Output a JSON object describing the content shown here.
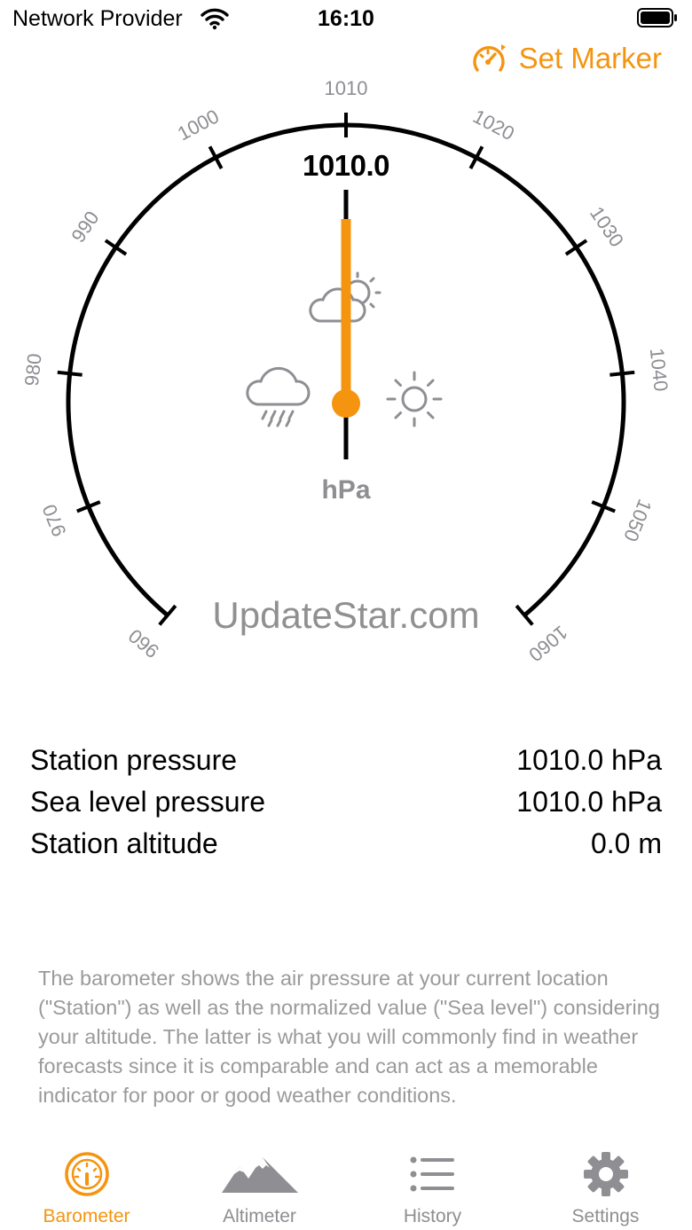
{
  "status_bar": {
    "carrier": "Network Provider",
    "time": "16:10"
  },
  "toolbar": {
    "set_marker_label": "Set Marker"
  },
  "gauge": {
    "value": "1010.0",
    "unit": "hPa",
    "ticks": [
      "960",
      "970",
      "980",
      "990",
      "1000",
      "1010",
      "1020",
      "1030",
      "1040",
      "1050",
      "1060"
    ],
    "needle_value": 1010.0,
    "range": [
      960,
      1060
    ],
    "icons": [
      "rain-cloud-icon",
      "partly-cloudy-icon",
      "sun-icon"
    ]
  },
  "watermark": "UpdateStar.com",
  "readings": [
    {
      "label": "Station pressure",
      "value": "1010.0 hPa"
    },
    {
      "label": "Sea level pressure",
      "value": "1010.0 hPa"
    },
    {
      "label": "Station altitude",
      "value": "0.0 m"
    }
  ],
  "description": "The barometer shows the air pressure at your current location (\"Station\") as well as the normalized value (\"Sea level\") considering your altitude. The latter is what you will commonly find in weather forecasts since it is comparable and can act as a memorable indicator for poor or good weather conditions.",
  "tabs": [
    {
      "label": "Barometer",
      "icon": "barometer-icon",
      "active": true
    },
    {
      "label": "Altimeter",
      "icon": "mountains-icon",
      "active": false
    },
    {
      "label": "History",
      "icon": "list-icon",
      "active": false
    },
    {
      "label": "Settings",
      "icon": "gear-icon",
      "active": false
    }
  ],
  "colors": {
    "accent": "#f5940f",
    "gray": "#8e8e93"
  }
}
